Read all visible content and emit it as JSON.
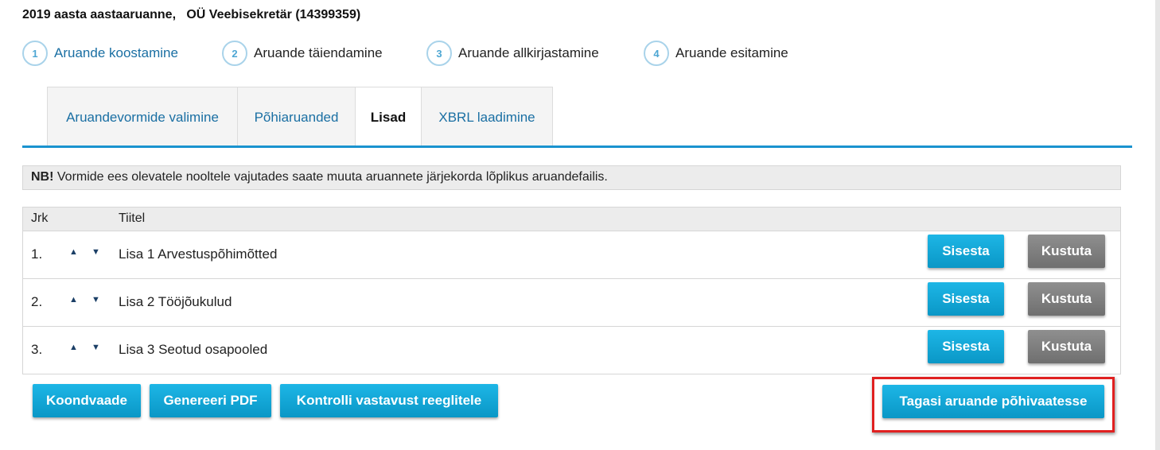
{
  "header": {
    "title": "2019 aasta aastaaruanne,   OÜ Veebisekretär (14399359)"
  },
  "steps": [
    {
      "num": "1",
      "label": "Aruande koostamine"
    },
    {
      "num": "2",
      "label": "Aruande täiendamine"
    },
    {
      "num": "3",
      "label": "Aruande allkirjastamine"
    },
    {
      "num": "4",
      "label": "Aruande esitamine"
    }
  ],
  "tabs": [
    {
      "label": "Aruandevormide valimine"
    },
    {
      "label": "Põhiaruanded"
    },
    {
      "label": "Lisad"
    },
    {
      "label": "XBRL laadimine"
    }
  ],
  "notice": {
    "bold": "NB!",
    "text": " Vormide ees olevatele nooltele vajutades saate muuta aruannete järjekorda lõplikus aruandefailis."
  },
  "table": {
    "headers": {
      "jrk": "Jrk",
      "title": "Tiitel"
    },
    "rows": [
      {
        "num": "1.",
        "title": "Lisa 1 Arvestuspõhimõtted",
        "edit": "Sisesta",
        "delete": "Kustuta"
      },
      {
        "num": "2.",
        "title": "Lisa 2 Tööjõukulud",
        "edit": "Sisesta",
        "delete": "Kustuta"
      },
      {
        "num": "3.",
        "title": "Lisa 3 Seotud osapooled",
        "edit": "Sisesta",
        "delete": "Kustuta"
      }
    ],
    "arrow_up": "▲",
    "arrow_down": "▼"
  },
  "actions": {
    "summary": "Koondvaade",
    "pdf": "Genereeri PDF",
    "validate": "Kontrolli vastavust reeglitele",
    "back": "Tagasi aruande põhivaatesse"
  },
  "colors": {
    "accent": "#1a93cf",
    "button_blue": "#0a97c6",
    "button_gray": "#7a7a7a",
    "highlight": "#e02020"
  }
}
